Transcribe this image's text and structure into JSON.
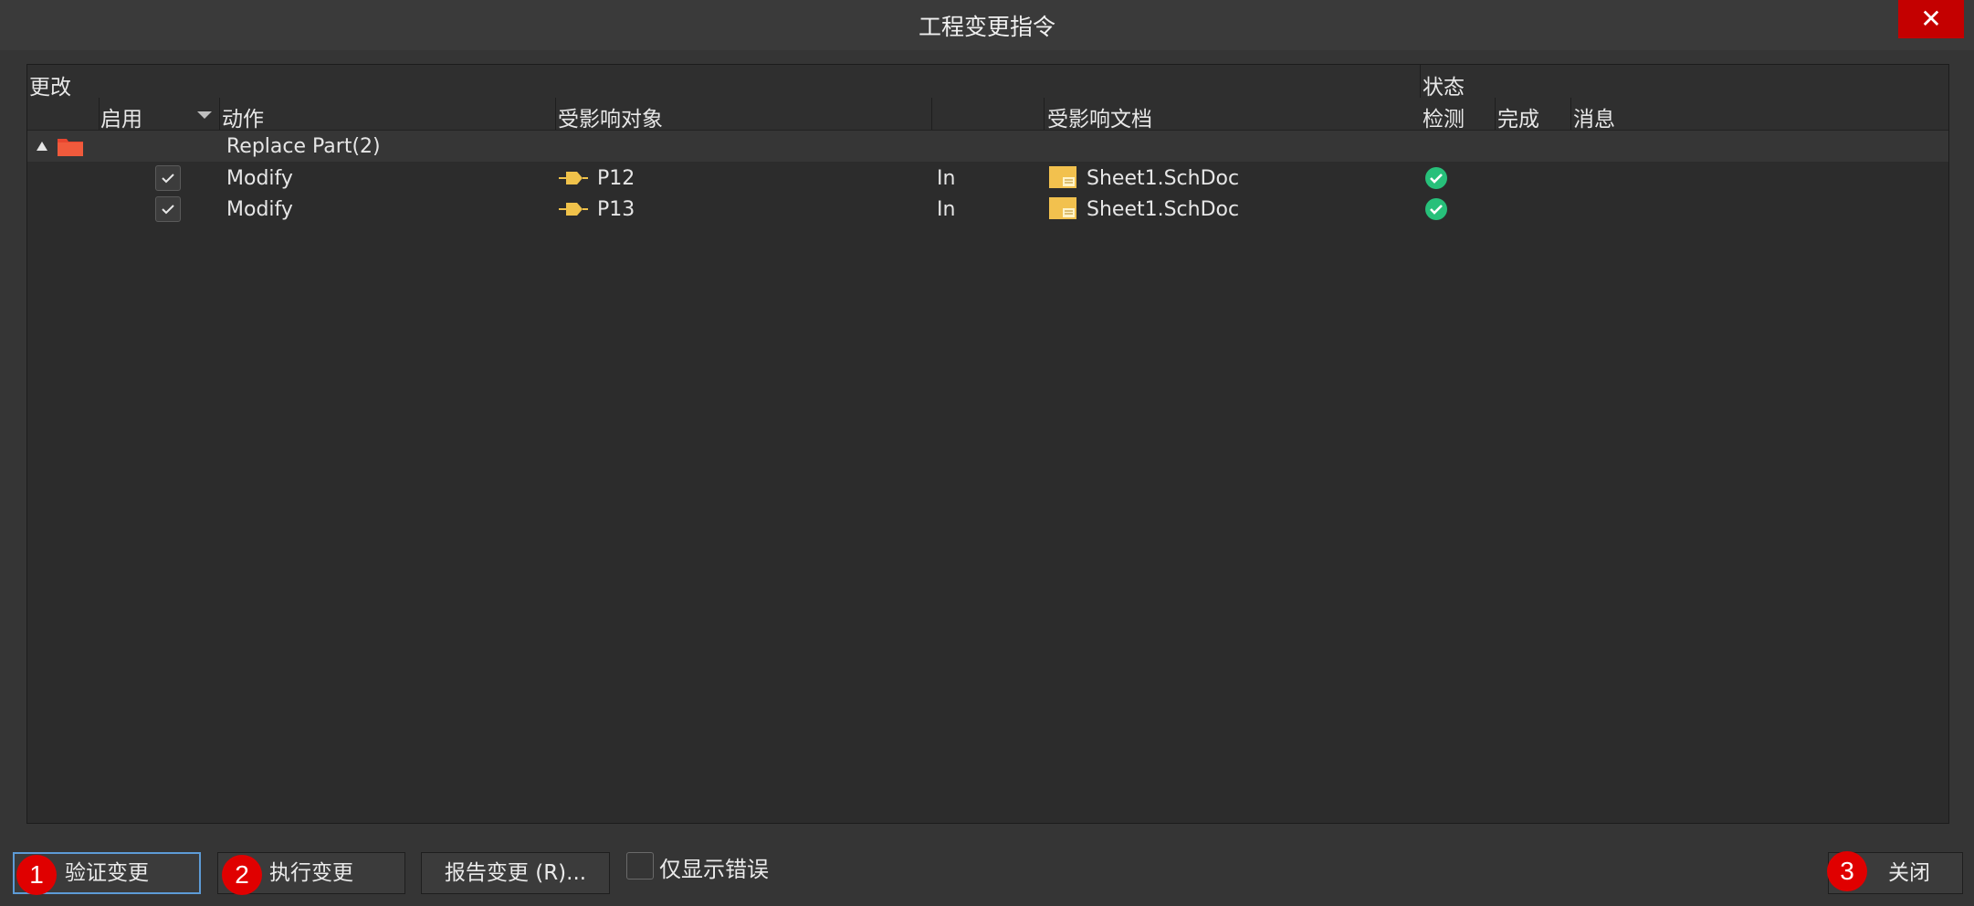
{
  "dialog": {
    "title": "工程变更指令",
    "close_glyph": "✕"
  },
  "columns": {
    "group_changes": "更改",
    "group_status": "状态",
    "enable": "启用",
    "action": "动作",
    "affected_object": "受影响对象",
    "affected_document": "受影响文档",
    "check": "检测",
    "done": "完成",
    "message": "消息"
  },
  "group": {
    "label": "Replace Part(2)",
    "icon": "folder-icon",
    "color": "#e8452f"
  },
  "rows": [
    {
      "enabled": true,
      "action": "Modify",
      "object_icon": "pin-icon",
      "object": "P12",
      "direction": "In",
      "doc_icon": "schematic-doc-icon",
      "document": "Sheet1.SchDoc",
      "check_status": "ok"
    },
    {
      "enabled": true,
      "action": "Modify",
      "object_icon": "pin-icon",
      "object": "P13",
      "direction": "In",
      "doc_icon": "schematic-doc-icon",
      "document": "Sheet1.SchDoc",
      "check_status": "ok"
    }
  ],
  "buttons": {
    "validate": "验证变更",
    "execute": "执行变更",
    "report": "报告变更 (R)...",
    "close": "关闭"
  },
  "filter": {
    "only_errors_label": "仅显示错误",
    "checked": false
  },
  "badges": {
    "one": "1",
    "two": "2",
    "three": "3"
  },
  "colors": {
    "accent_focus": "#5d9bd6",
    "badge": "#e00000",
    "ok": "#27c07a",
    "close_bg": "#c40000"
  }
}
